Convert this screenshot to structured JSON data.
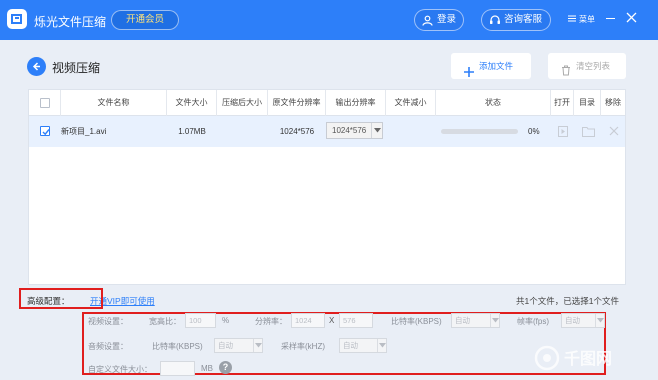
{
  "app": {
    "title": "烁光文件压缩",
    "vip_button": "开通会员",
    "login_button": "登录",
    "support_button": "咨询客服",
    "menu_button": "菜单"
  },
  "toolbar": {
    "page_title": "视频压缩",
    "add_file": "添加文件",
    "clear_list": "清空列表"
  },
  "table": {
    "columns": [
      "",
      "文件名称",
      "文件大小",
      "压缩后大小",
      "原文件分辨率",
      "输出分辨率",
      "文件减小",
      "状态",
      "打开",
      "目录",
      "移除"
    ],
    "rows": [
      {
        "checked": true,
        "name": "新项目_1.avi",
        "size": "1.07MB",
        "compressed_size": "",
        "source_resolution": "1024*576",
        "output_resolution": "1024*576",
        "reduced": "",
        "progress": 0,
        "progress_text": "0%"
      }
    ]
  },
  "advanced": {
    "label": "高级配置：",
    "link": "开通VIP即可使用",
    "file_count": "共1个文件，已选择1个文件",
    "video_settings": "视频设置：",
    "aspect_label": "宽高比：",
    "aspect_value": "100",
    "aspect_unit": "%",
    "resolution_label": "分辨率：",
    "res_w": "1024",
    "res_x": "X",
    "res_h": "576",
    "video_bitrate_label": "比特率(KBPS)",
    "video_bitrate_value": "自动",
    "fps_label": "帧率(fps)",
    "fps_value": "自动",
    "audio_settings": "音频设置：",
    "audio_bitrate_label": "比特率(KBPS)",
    "audio_bitrate_value": "自动",
    "sample_rate_label": "采样率(kHZ)",
    "sample_rate_value": "自动",
    "custom_size_label": "自定义文件大小：",
    "custom_size_value": "",
    "custom_size_unit": "MB",
    "help_text": "?"
  },
  "watermark": "千图网",
  "colors": {
    "primary": "#2d7ff9",
    "highlight": "#e01e1e",
    "vip_text": "#ffe37a"
  },
  "icons": [
    "logo-icon",
    "user-icon",
    "headset-icon",
    "menu-icon",
    "minimize-icon",
    "close-icon",
    "back-arrow-icon",
    "plus-icon",
    "trash-icon",
    "play-icon",
    "folder-icon",
    "remove-icon",
    "help-icon"
  ]
}
